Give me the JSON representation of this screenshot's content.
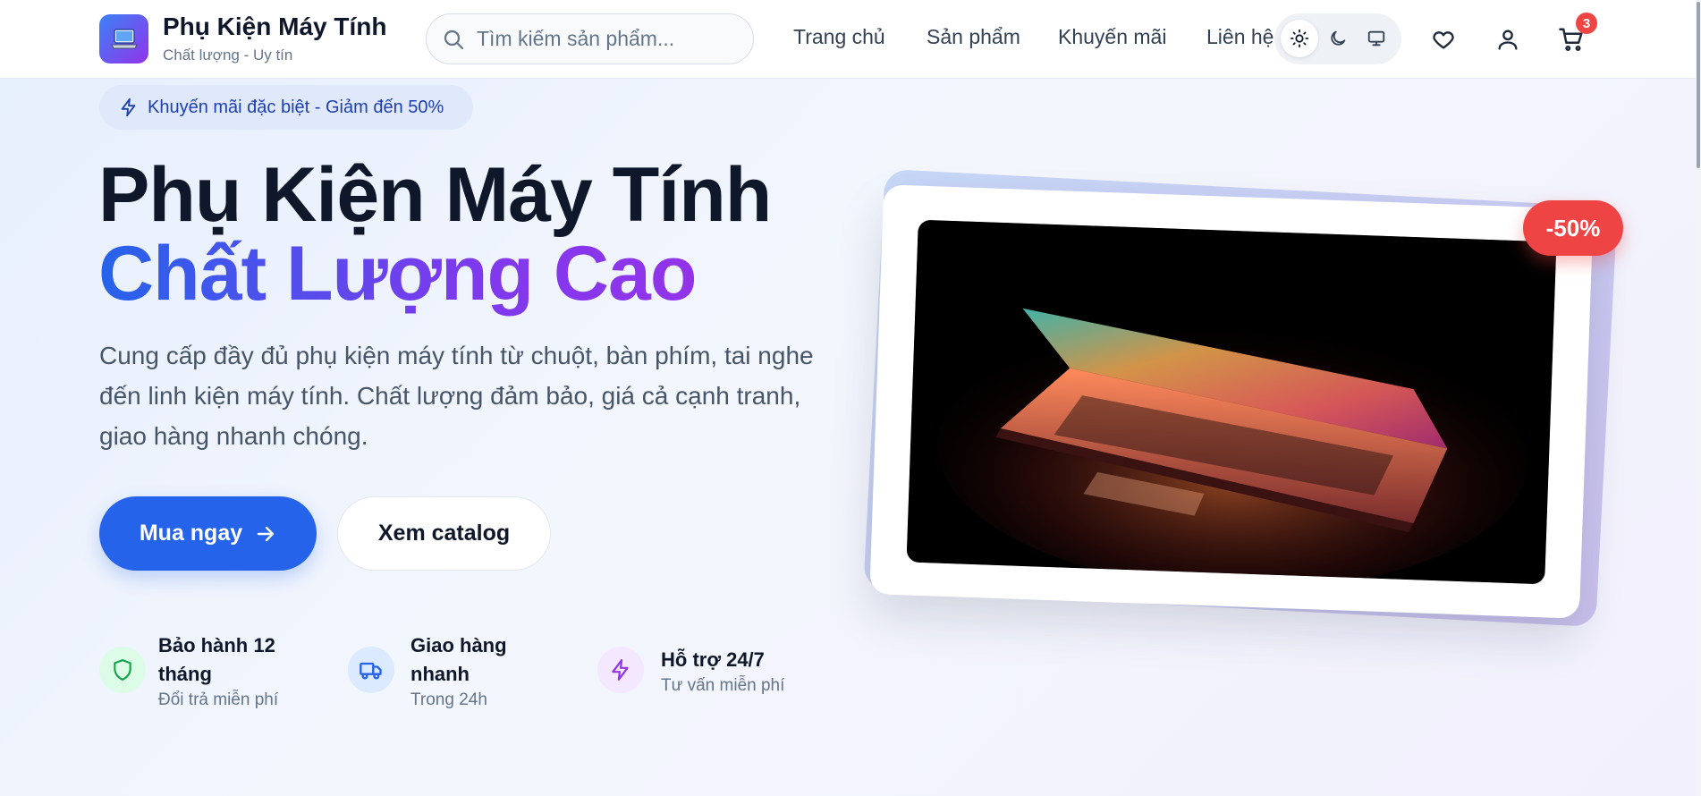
{
  "brand": {
    "title": "Phụ Kiện Máy Tính",
    "subtitle": "Chất lượng - Uy tín",
    "logo_icon": "laptop-icon"
  },
  "search": {
    "placeholder": "Tìm kiếm sản phẩm...",
    "value": ""
  },
  "nav": [
    {
      "label": "Trang chủ"
    },
    {
      "label": "Sản phẩm"
    },
    {
      "label": "Khuyến mãi"
    },
    {
      "label": "Liên hệ"
    }
  ],
  "theme": {
    "options": [
      "sun-icon",
      "moon-icon",
      "monitor-icon"
    ],
    "active": "sun-icon"
  },
  "header_icons": {
    "wishlist": "heart-icon",
    "account": "user-icon",
    "cart": "cart-icon",
    "cart_count": "3"
  },
  "hero": {
    "promo": "Khuyến mãi đặc biệt - Giảm đến 50%",
    "title_line1": "Phụ Kiện Máy Tính",
    "title_line2": "Chất Lượng Cao",
    "description": "Cung cấp đầy đủ phụ kiện máy tính từ chuột, bàn phím, tai nghe đến linh kiện máy tính. Chất lượng đảm bảo, giá cả cạnh tranh, giao hàng nhanh chóng.",
    "primary_button": "Mua ngay",
    "secondary_button": "Xem catalog",
    "discount_badge": "-50%"
  },
  "features": [
    {
      "icon": "shield-icon",
      "title": "Bảo hành 12 tháng",
      "subtitle": "Đổi trả miễn phí"
    },
    {
      "icon": "truck-icon",
      "title": "Giao hàng nhanh",
      "subtitle": "Trong 24h"
    },
    {
      "icon": "bolt-icon",
      "title": "Hỗ trợ 24/7",
      "subtitle": "Tư vấn miễn phí"
    }
  ],
  "colors": {
    "primary": "#2563eb",
    "accent_purple": "#9333ea",
    "badge_red": "#ef4444",
    "text_dark": "#0f172a",
    "text_muted": "#64748b"
  }
}
